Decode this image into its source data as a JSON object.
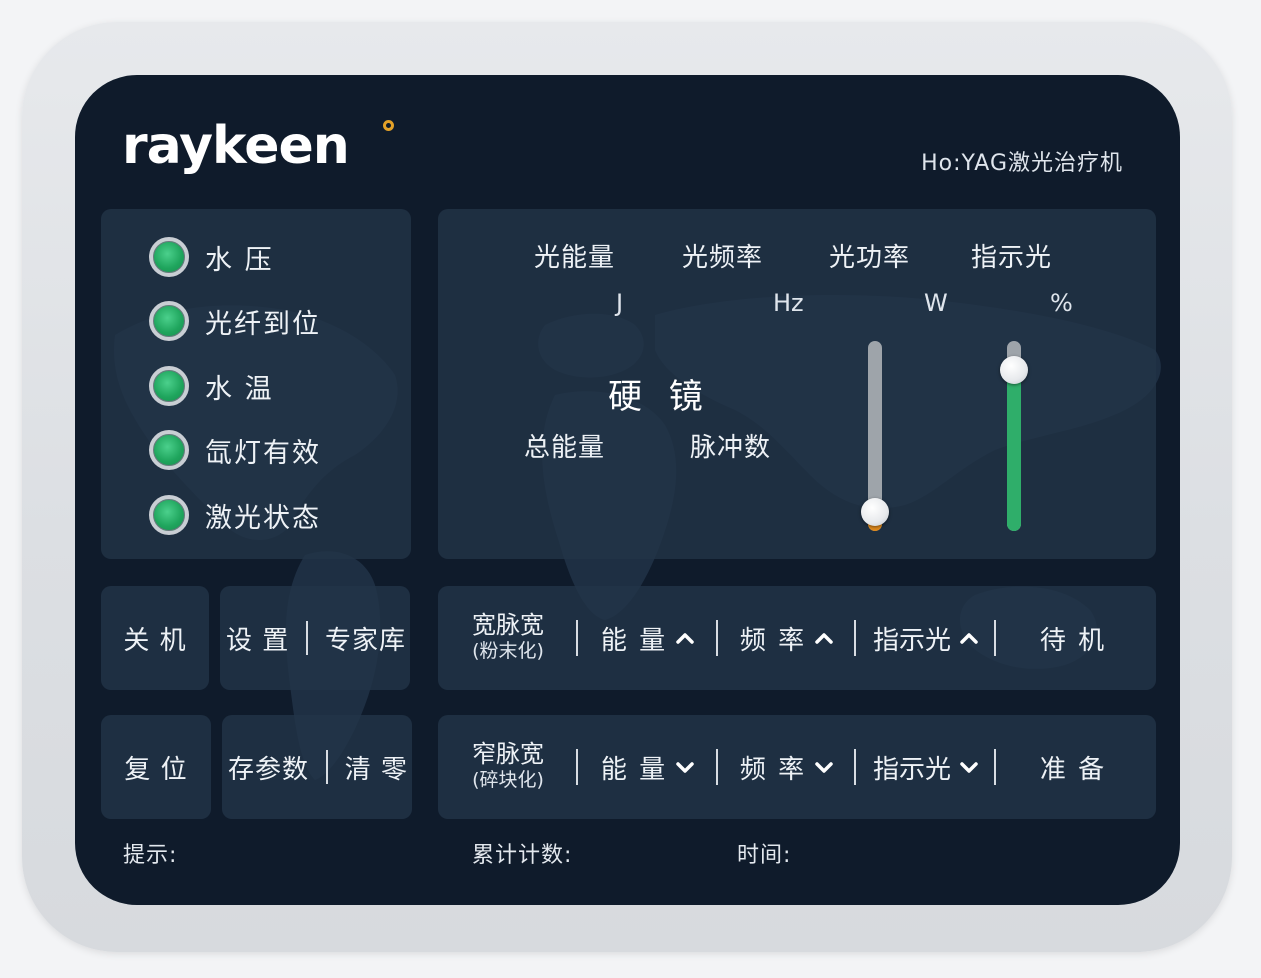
{
  "header": {
    "logo": "raykeen",
    "model": "Ho:YAG激光治疗机"
  },
  "status": [
    {
      "label": "水 压",
      "state": "ok"
    },
    {
      "label": "光纤到位",
      "state": "ok"
    },
    {
      "label": "水 温",
      "state": "ok"
    },
    {
      "label": "氙灯有效",
      "state": "ok"
    },
    {
      "label": "激光状态",
      "state": "ok"
    }
  ],
  "params": {
    "energy": {
      "label": "光能量",
      "unit": "J"
    },
    "frequency": {
      "label": "光频率",
      "unit": "Hz"
    },
    "power": {
      "label": "光功率",
      "unit": "W",
      "level": 0.1
    },
    "aiming": {
      "label": "指示光",
      "unit": "%",
      "level": 0.85
    },
    "scope": "硬 镜",
    "total_energy_label": "总能量",
    "pulse_count_label": "脉冲数"
  },
  "left_buttons": {
    "shutdown": "关  机",
    "settings": "设  置",
    "expert": "专家库",
    "reset": "复  位",
    "save": "存参数",
    "clear": "清  零"
  },
  "wide_bar": {
    "mode_line1": "宽脉宽",
    "mode_line2": "(粉末化)",
    "energy": "能 量",
    "frequency": "频 率",
    "aiming": "指示光",
    "action": "待 机",
    "direction": "up"
  },
  "narrow_bar": {
    "mode_line1": "窄脉宽",
    "mode_line2": "(碎块化)",
    "energy": "能 量",
    "frequency": "频 率",
    "aiming": "指示光",
    "action": "准 备",
    "direction": "down"
  },
  "footer": {
    "hint": "提示:",
    "count": "累计计数:",
    "time": "时间:"
  },
  "colors": {
    "screen_bg": "#0f1b2b",
    "panel": "#223448",
    "led_green": "#1fa55d",
    "power_fill": "#e08a1c",
    "aiming_fill": "#2fae6a",
    "logo_dot": "#e3a128"
  }
}
